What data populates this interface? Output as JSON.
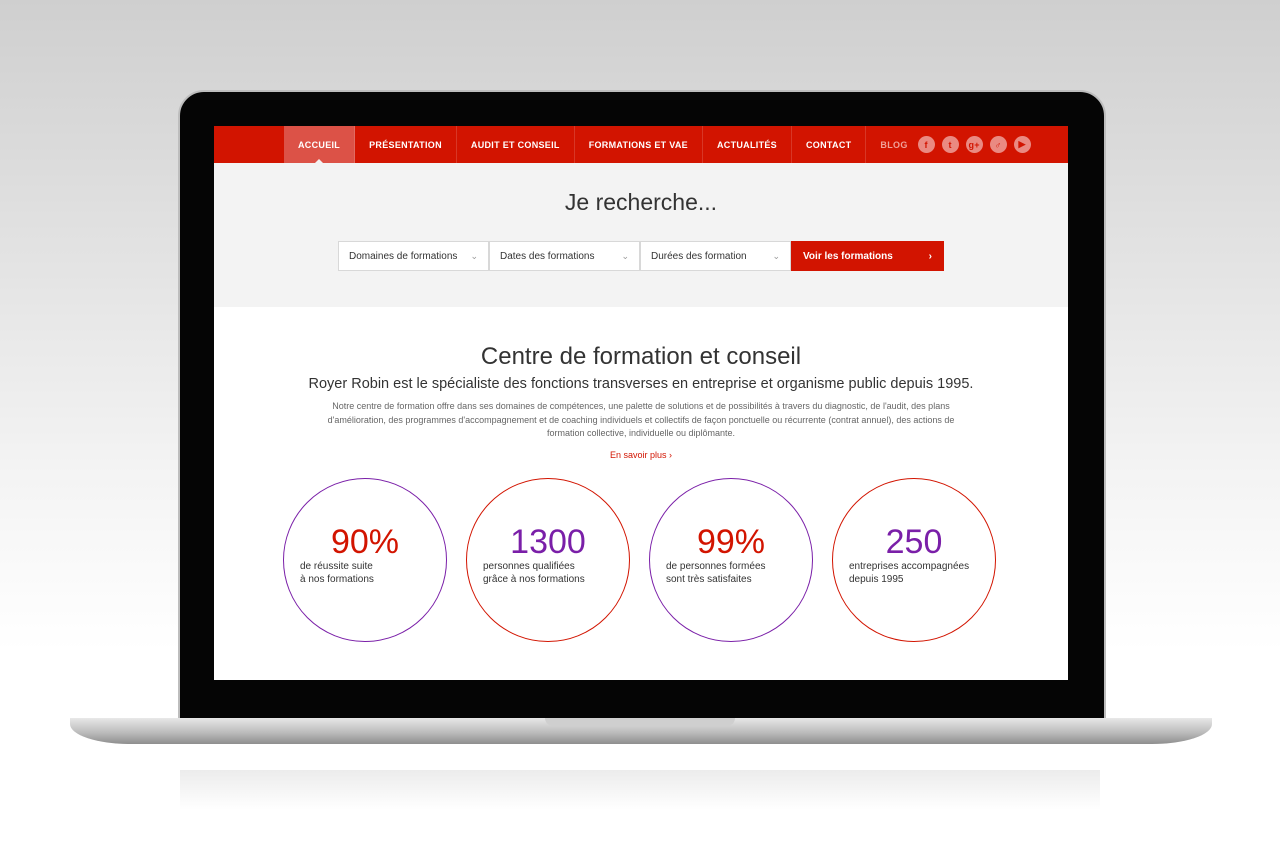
{
  "nav": {
    "items": [
      "ACCUEIL",
      "PRÉSENTATION",
      "AUDIT ET CONSEIL",
      "FORMATIONS ET VAE",
      "ACTUALITÉS",
      "CONTACT"
    ],
    "blog": "BLOG",
    "social": [
      "facebook-icon",
      "twitter-icon",
      "google-plus-icon",
      "male-symbol-icon",
      "play-icon"
    ]
  },
  "search": {
    "title": "Je recherche...",
    "selects": [
      "Domaines de formations",
      "Dates des formations",
      "Durées des formation"
    ],
    "button": "Voir les formations"
  },
  "intro": {
    "title": "Centre de formation et conseil",
    "subtitle": "Royer Robin est le spécialiste des fonctions transverses en entreprise et organisme public depuis 1995.",
    "body": "Notre centre de formation offre dans ses domaines de compétences, une palette de solutions et de possibilités à travers du diagnostic, de l'audit, des plans d'amélioration, des programmes d'accompagnement et de coaching individuels et collectifs de façon ponctuelle ou récurrente (contrat annuel), des actions de formation collective, individuelle ou diplômante.",
    "more": "En savoir plus"
  },
  "stats": [
    {
      "value": "90%",
      "line1": "de réussite suite",
      "line2": "à nos formations"
    },
    {
      "value": "1300",
      "line1": "personnes qualifiées",
      "line2": "grâce à nos formations"
    },
    {
      "value": "99%",
      "line1": "de personnes formées",
      "line2": "sont très satisfaites"
    },
    {
      "value": "250",
      "line1": "entreprises accompagnées",
      "line2": "depuis 1995"
    }
  ],
  "colors": {
    "brand_red": "#d21400",
    "purple": "#7a1fa8"
  }
}
